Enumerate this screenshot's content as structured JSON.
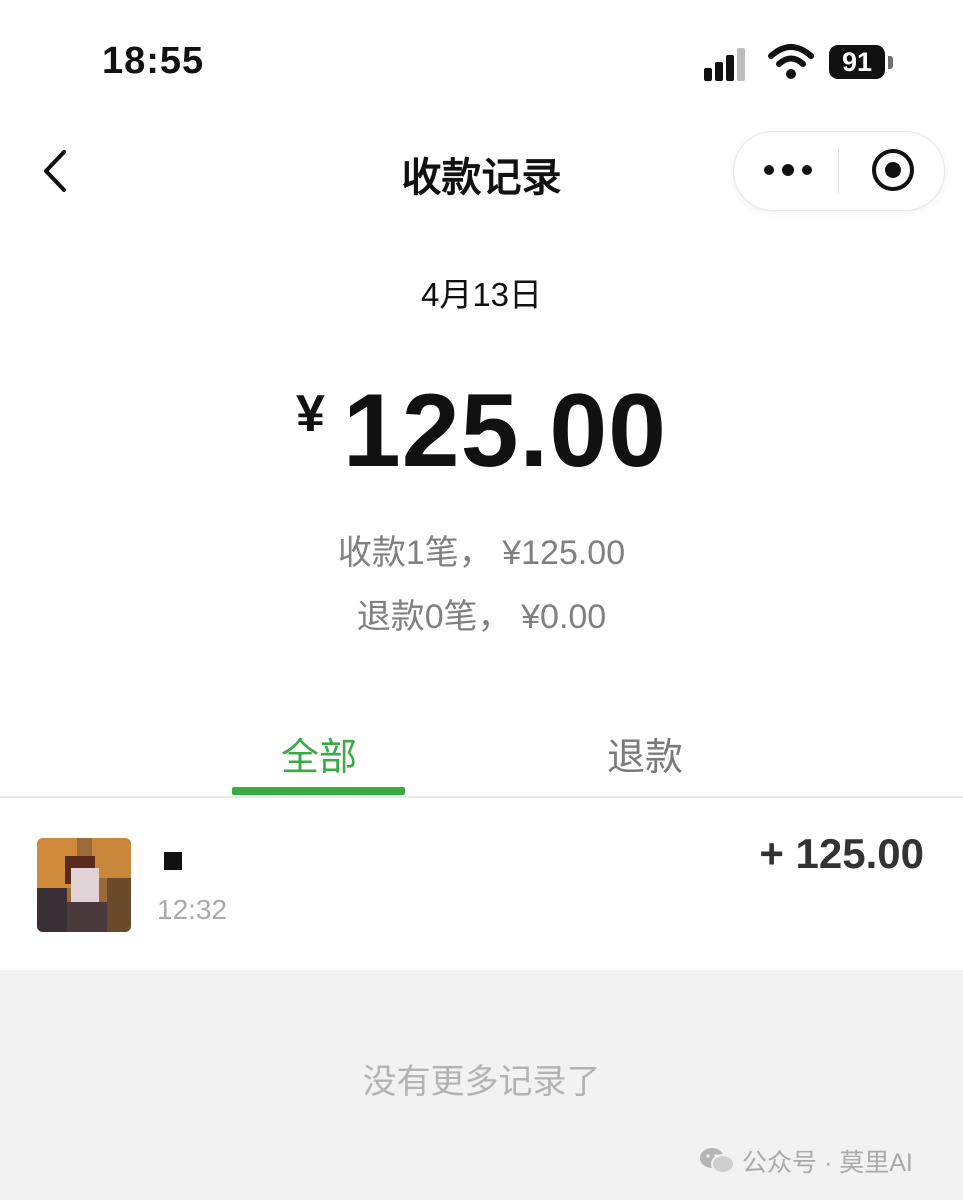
{
  "status_bar": {
    "time": "18:55",
    "battery": "91"
  },
  "nav": {
    "title": "收款记录",
    "more_icon": "more-dots-icon",
    "close_icon": "target-circle-icon"
  },
  "summary": {
    "date": "4月13日",
    "currency": "¥",
    "total": "125.00",
    "received_line": "收款1笔， ¥125.00",
    "refund_line": "退款0笔， ¥0.00"
  },
  "tabs": [
    {
      "label": "全部",
      "active": true
    },
    {
      "label": "退款",
      "active": false
    }
  ],
  "records": [
    {
      "time": "12:32",
      "amount": "+ 125.00"
    }
  ],
  "footer": {
    "no_more": "没有更多记录了",
    "watermark": "公众号 · 莫里AI"
  },
  "colors": {
    "accent": "#3aaa44",
    "muted_text": "#808080",
    "footer_bg": "#f2f2f2"
  }
}
